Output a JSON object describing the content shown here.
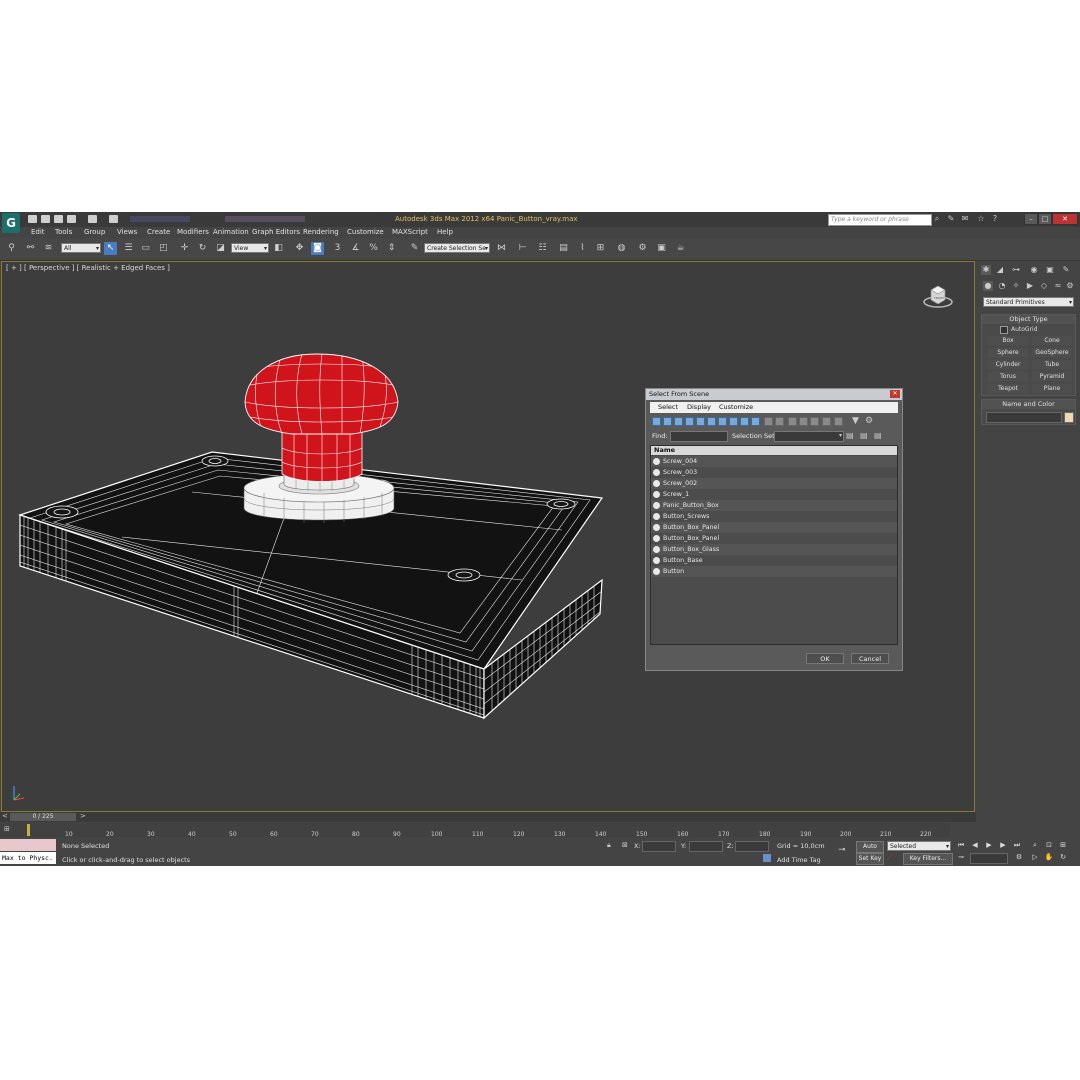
{
  "window": {
    "app_logo": "G",
    "title": "Autodesk 3ds Max  2012 x64      Panic_Button_vray.max",
    "search_placeholder": "Type a keyword or phrase"
  },
  "menu": [
    "Edit",
    "Tools",
    "Group",
    "Views",
    "Create",
    "Modifiers",
    "Animation",
    "Graph Editors",
    "Rendering",
    "Customize",
    "MAXScript",
    "Help"
  ],
  "toolbar": {
    "selection_filter": "All",
    "ref_coord": "View",
    "named_selection": "Create Selection Se"
  },
  "viewport": {
    "label": "[ + ] [ Perspective ] [ Realistic + Edged Faces ]",
    "viewcube_label": "FRONT"
  },
  "command_panel": {
    "category_dropdown": "Standard Primitives",
    "object_type_header": "Object Type",
    "autogrid_label": "AutoGrid",
    "primitives": [
      "Box",
      "Cone",
      "Sphere",
      "GeoSphere",
      "Cylinder",
      "Tube",
      "Torus",
      "Pyramid",
      "Teapot",
      "Plane"
    ],
    "name_color_header": "Name and Color"
  },
  "dialog": {
    "title": "Select From Scene",
    "tabs": [
      "Select",
      "Display",
      "Customize"
    ],
    "find_label": "Find:",
    "selection_set_label": "Selection Set:",
    "column_header": "Name",
    "items": [
      "Screw_004",
      "Screw_003",
      "Screw_002",
      "Screw_1",
      "Panic_Button_Box",
      "Button_Screws",
      "Button_Box_Panel",
      "Button_Box_Panel",
      "Button_Box_Glass",
      "Button_Base",
      "Button"
    ],
    "ok_label": "OK",
    "cancel_label": "Cancel"
  },
  "timeline": {
    "frame_display": "0 / 225",
    "ticks": [
      "10",
      "20",
      "30",
      "40",
      "50",
      "60",
      "70",
      "80",
      "90",
      "100",
      "110",
      "120",
      "130",
      "140",
      "150",
      "160",
      "170",
      "180",
      "190",
      "200",
      "210",
      "220"
    ]
  },
  "status": {
    "maxscript_text": "Max to Physc.",
    "selection": "None Selected",
    "prompt": "Click or click-and-drag to select objects",
    "x_label": "X:",
    "y_label": "Y:",
    "z_label": "Z:",
    "grid": "Grid = 10,0cm",
    "add_time_tag": "Add Time Tag",
    "auto_key": "Auto Key",
    "auto_key_dropdown": "Selected",
    "set_key": "Set Key",
    "key_filters": "Key Filters..."
  },
  "colors": {
    "button_red": "#d0141b",
    "viewport_bg": "#3d3d3d",
    "active_border": "#8a7a30",
    "title_text": "#e2c060"
  }
}
